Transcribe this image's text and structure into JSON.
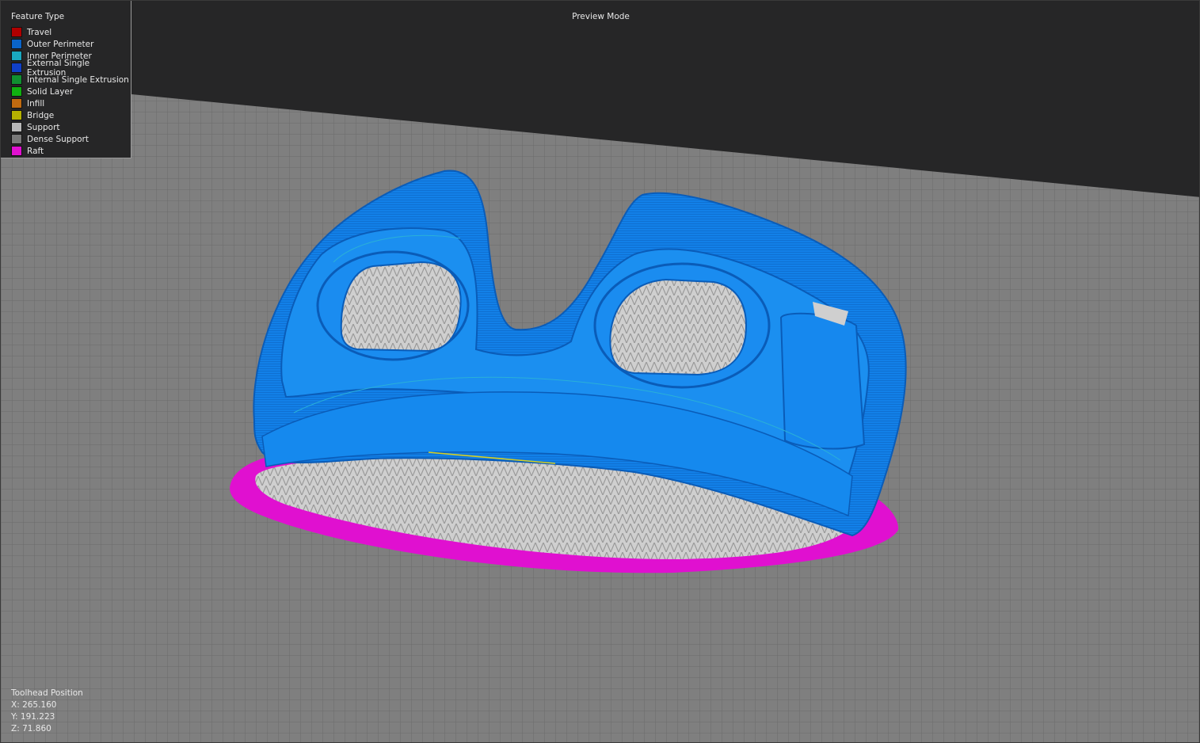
{
  "viewport": {
    "mode_label": "Preview Mode"
  },
  "legend": {
    "title": "Feature Type",
    "items": [
      {
        "label": "Travel",
        "color": "#b00000"
      },
      {
        "label": "Outer Perimeter",
        "color": "#0a64c8"
      },
      {
        "label": "Inner Perimeter",
        "color": "#1aa8c0"
      },
      {
        "label": "External Single Extrusion",
        "color": "#1040c8"
      },
      {
        "label": "Internal Single Extrusion",
        "color": "#109030"
      },
      {
        "label": "Solid Layer",
        "color": "#10b010"
      },
      {
        "label": "Infill",
        "color": "#c06a10"
      },
      {
        "label": "Bridge",
        "color": "#b4b000"
      },
      {
        "label": "Support",
        "color": "#b8b8b8"
      },
      {
        "label": "Dense Support",
        "color": "#787878"
      },
      {
        "label": "Raft",
        "color": "#e010d0"
      }
    ]
  },
  "toolhead": {
    "title": "Toolhead Position",
    "x": "X: 265.160",
    "y": "Y: 191.223",
    "z": "Z: 71.860"
  },
  "colors": {
    "background": "#262627",
    "bed": "#7f7f7f",
    "grid_line": "#6a6a6a",
    "model": "#1280e8",
    "model_dark": "#0b5fbf",
    "raft": "#e010d0",
    "support": "#c6c6c6"
  }
}
